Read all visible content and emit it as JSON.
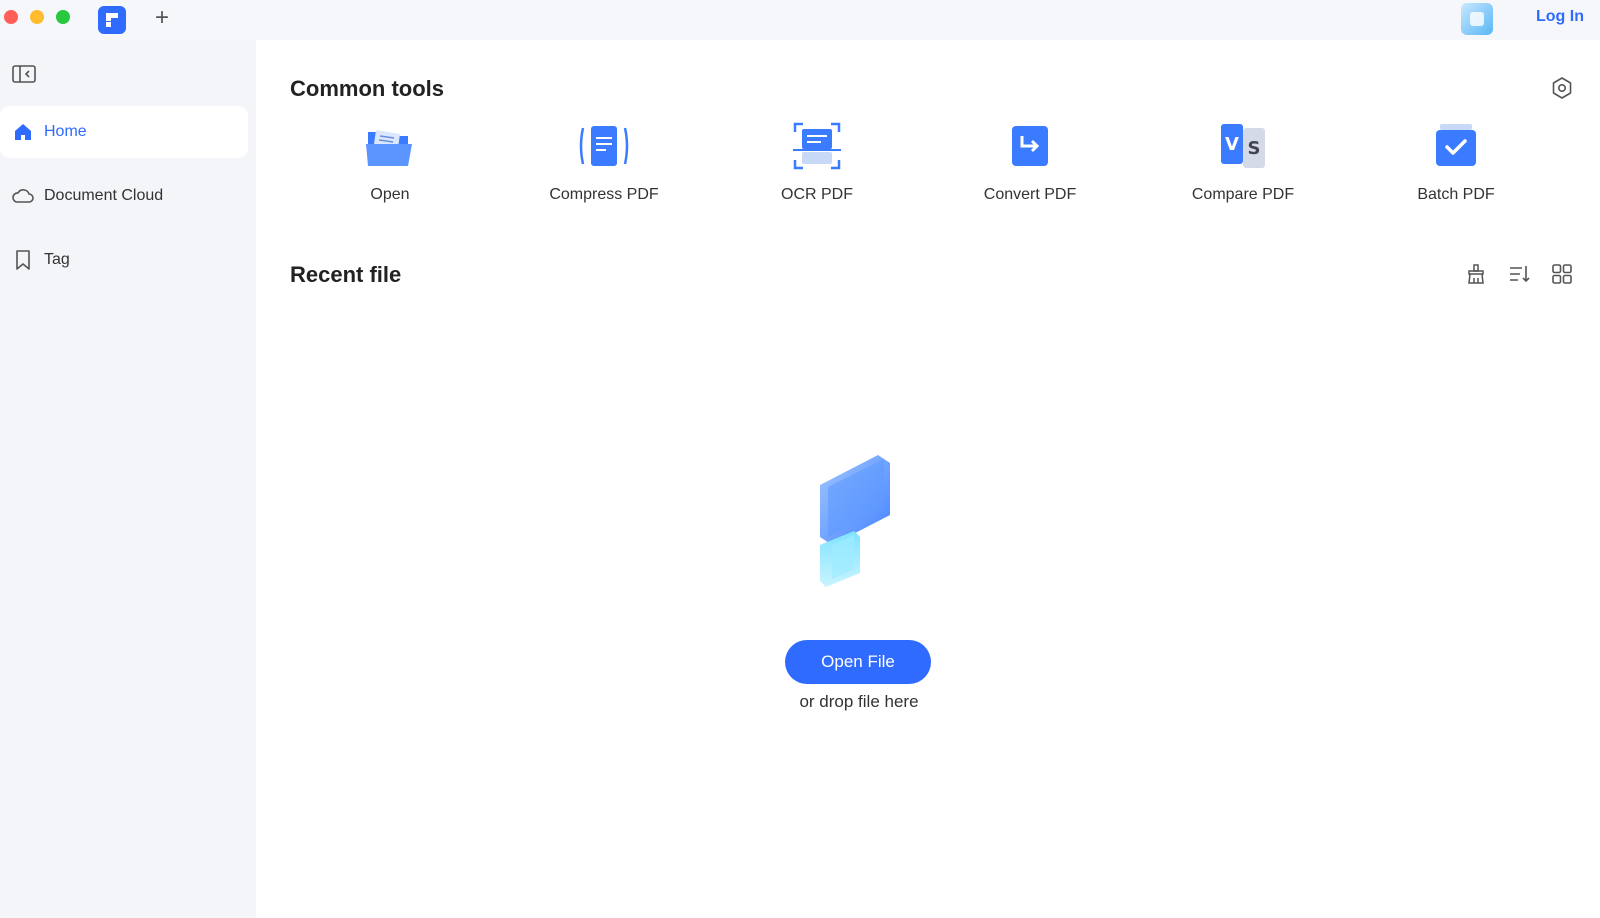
{
  "titlebar": {
    "login_label": "Log In"
  },
  "sidebar": {
    "items": [
      {
        "label": "Home",
        "icon": "home-icon",
        "active": true
      },
      {
        "label": "Document Cloud",
        "icon": "cloud-icon",
        "active": false
      },
      {
        "label": "Tag",
        "icon": "bookmark-icon",
        "active": false
      }
    ]
  },
  "common_tools": {
    "title": "Common tools",
    "tools": [
      {
        "label": "Open",
        "icon": "open-folder-icon"
      },
      {
        "label": "Compress PDF",
        "icon": "compress-pdf-icon"
      },
      {
        "label": "OCR PDF",
        "icon": "ocr-pdf-icon"
      },
      {
        "label": "Convert PDF",
        "icon": "convert-pdf-icon"
      },
      {
        "label": "Compare PDF",
        "icon": "compare-pdf-icon"
      },
      {
        "label": "Batch PDF",
        "icon": "batch-pdf-icon"
      }
    ]
  },
  "recent": {
    "title": "Recent file",
    "open_button": "Open File",
    "drop_text": "or drop file here"
  },
  "colors": {
    "accent": "#2f6bff",
    "sidebar_bg": "#f4f5f9"
  }
}
